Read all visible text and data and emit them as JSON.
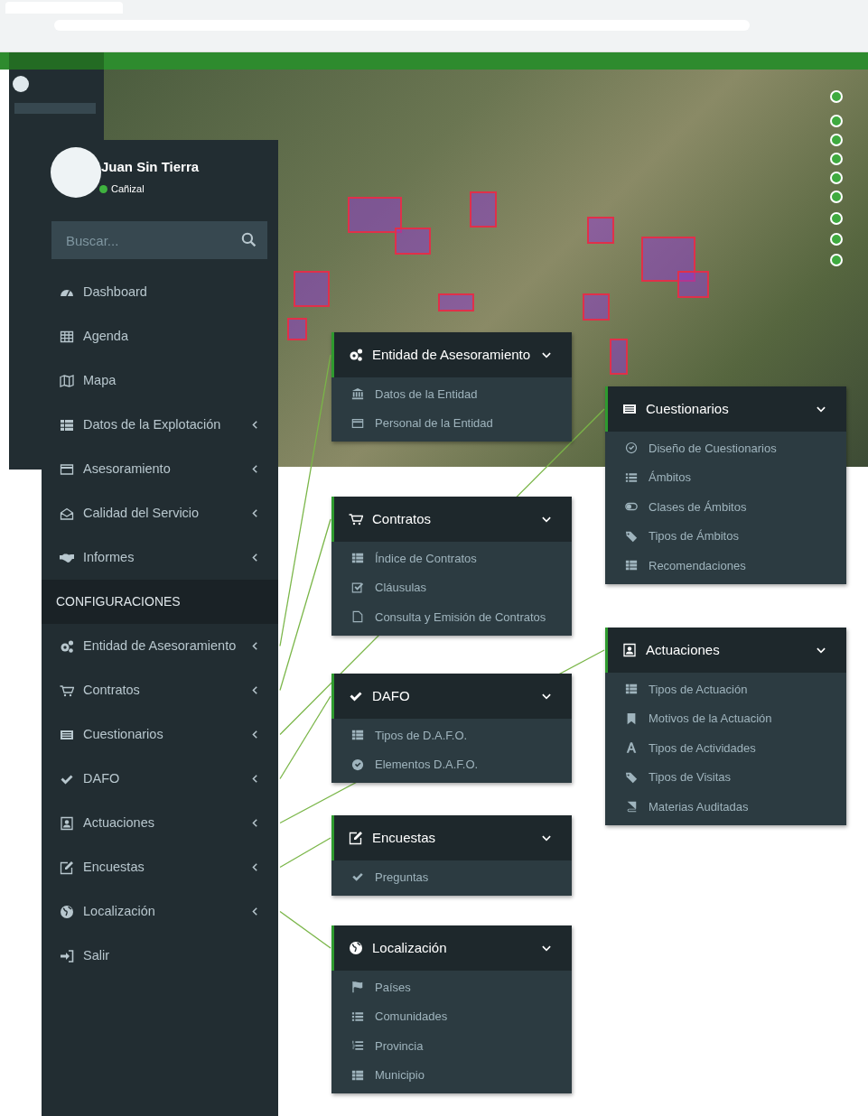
{
  "user": {
    "name": "Juan Sin Tierra",
    "status": "Cañizal",
    "online": true
  },
  "search": {
    "placeholder": "Buscar..."
  },
  "sidebar": {
    "items": [
      {
        "kind": "link",
        "label": "Dashboard",
        "expandable": false
      },
      {
        "kind": "link",
        "label": "Agenda",
        "expandable": false
      },
      {
        "kind": "link",
        "label": "Mapa",
        "expandable": false
      },
      {
        "kind": "link",
        "label": "Datos de la Explotación",
        "expandable": true
      },
      {
        "kind": "link",
        "label": "Asesoramiento",
        "expandable": true
      },
      {
        "kind": "link",
        "label": "Calidad del Servicio",
        "expandable": true
      },
      {
        "kind": "link",
        "label": "Informes",
        "expandable": true
      },
      {
        "kind": "header",
        "label": "CONFIGURACIONES"
      },
      {
        "kind": "link",
        "label": "Entidad de Asesoramiento",
        "expandable": true,
        "submenu": {
          "title": "Entidad de Asesoramiento",
          "expanded": true,
          "items": [
            "Datos de la Entidad",
            "Personal de la Entidad"
          ]
        }
      },
      {
        "kind": "link",
        "label": "Contratos",
        "expandable": true,
        "submenu": {
          "title": "Contratos",
          "expanded": true,
          "items": [
            "Índice de Contratos",
            "Cláusulas",
            "Consulta y Emisión de Contratos"
          ]
        }
      },
      {
        "kind": "link",
        "label": "Cuestionarios",
        "expandable": true,
        "submenu": {
          "title": "Cuestionarios",
          "expanded": true,
          "items": [
            "Diseño de Cuestionarios",
            "Ámbitos",
            "Clases de Ámbitos",
            "Tipos de Ámbitos",
            "Recomendaciones"
          ]
        }
      },
      {
        "kind": "link",
        "label": "DAFO",
        "expandable": true,
        "submenu": {
          "title": "DAFO",
          "expanded": true,
          "items": [
            "Tipos de D.A.F.O.",
            "Elementos D.A.F.O."
          ]
        }
      },
      {
        "kind": "link",
        "label": "Actuaciones",
        "expandable": true,
        "submenu": {
          "title": "Actuaciones",
          "expanded": true,
          "items": [
            "Tipos de Actuación",
            "Motivos de la Actuación",
            "Tipos de Actividades",
            "Tipos de Visitas",
            "Materias Auditadas"
          ]
        }
      },
      {
        "kind": "link",
        "label": "Encuestas",
        "expandable": true,
        "submenu": {
          "title": "Encuestas",
          "expanded": true,
          "items": [
            "Preguntas"
          ]
        }
      },
      {
        "kind": "link",
        "label": "Localización",
        "expandable": true,
        "submenu": {
          "title": "Localización",
          "expanded": true,
          "items": [
            "Países",
            "Comunidades",
            "Provincia",
            "Municipio"
          ]
        }
      },
      {
        "kind": "link",
        "label": "Salir",
        "expandable": false
      }
    ]
  }
}
